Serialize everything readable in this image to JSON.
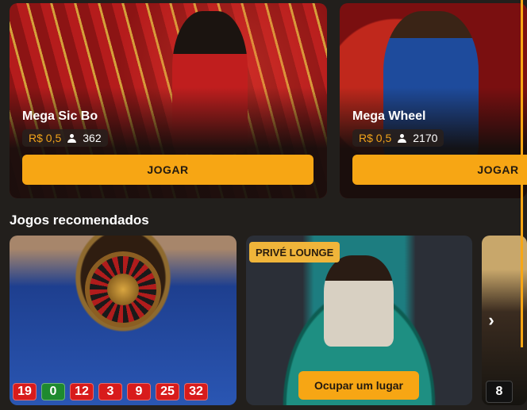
{
  "live_games": [
    {
      "title": "Mega Sic Bo",
      "min_bet": "R$ 0,5",
      "players": "362",
      "button": "JOGAR"
    },
    {
      "title": "Mega Wheel",
      "min_bet": "R$ 0,5",
      "players": "2170",
      "button": "JOGAR"
    }
  ],
  "recommended": {
    "title": "Jogos recomendados",
    "roulette": {
      "numbers": [
        "19",
        "0",
        "12",
        "3",
        "9",
        "25",
        "32"
      ]
    },
    "blackjack": {
      "badge": "PRIVÉ LOUNGE",
      "button": "Ocupar um lugar"
    },
    "third": {
      "number": "8"
    }
  },
  "colors": {
    "accent": "#f7a614",
    "background": "#221f1c"
  }
}
